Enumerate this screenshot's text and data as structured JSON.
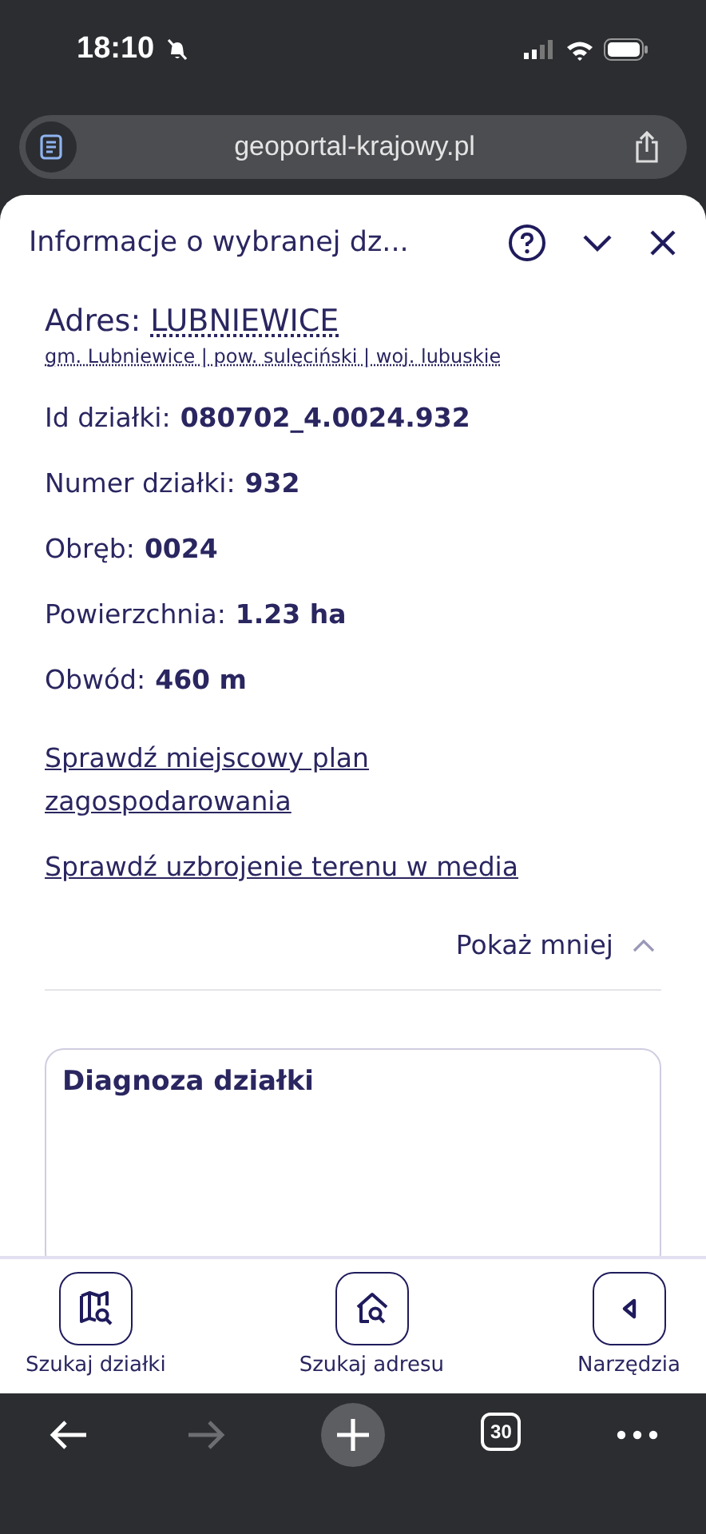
{
  "status_bar": {
    "time": "18:10",
    "silent": true
  },
  "address_bar": {
    "url": "geoportal-krajowy.pl"
  },
  "panel": {
    "title": "Informacje o wybranej dz...",
    "address_label": "Adres:",
    "address_value": "LUBNIEWICE",
    "address_detail": "gm. Lubniewice | pow. sulęciński | woj. lubuskie",
    "fields": [
      {
        "label": "Id działki:",
        "value": "080702_4.0024.932"
      },
      {
        "label": "Numer działki:",
        "value": "932"
      },
      {
        "label": "Obręb:",
        "value": "0024"
      },
      {
        "label": "Powierzchnia:",
        "value": "1.23 ha"
      },
      {
        "label": "Obwód:",
        "value": "460 m"
      }
    ],
    "links": [
      "Sprawdź miejscowy plan zagospodarowania",
      "Sprawdź uzbrojenie terenu w media"
    ],
    "toggle": {
      "label": "Pokaż mniej",
      "expanded": true
    },
    "section": {
      "title": "Diagnoza działki"
    }
  },
  "bottom_nav": [
    {
      "kind": "map",
      "label": "Szukaj działki"
    },
    {
      "kind": "house",
      "label": "Szukaj adresu"
    },
    {
      "kind": "tools",
      "label": "Narzędzia"
    }
  ],
  "browser_toolbar": {
    "back_disabled": false,
    "forward_disabled": true,
    "tab_count": "30"
  }
}
